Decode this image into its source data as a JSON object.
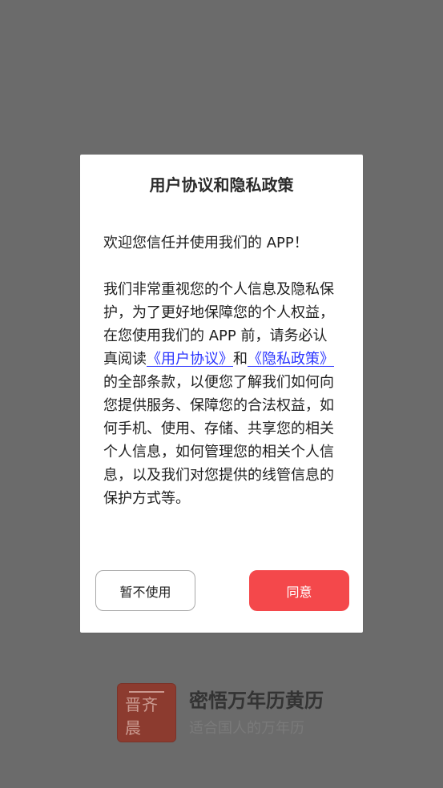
{
  "theme": {
    "overlay_color": "#6b6b6b",
    "modal_bg": "#ffffff",
    "link_color": "#2b35ff",
    "accept_button_color": "#f4484b",
    "decline_border_color": "#a8a8a8",
    "brand_logo_color": "#8c3b2f"
  },
  "modal": {
    "title": "用户协议和隐私政策",
    "welcome": "欢迎您信任并使用我们的 APP！",
    "paragraph_before_links": "我们非常重视您的个人信息及隐私保护，为了更好地保障您的个人权益，在您使用我们的 APP 前，请务必认真阅读",
    "user_agreement_link": "《用户协议》",
    "conjunction": "和",
    "privacy_policy_link": "《隐私政策》",
    "paragraph_after_links": "的全部条款，以便您了解我们如何向您提供服务、保障您的合法权益，如何手机、使用、存储、共享您的相关个人信息，如何管理您的相关个人信息，以及我们对您提供的线管信息的保护方式等。",
    "buttons": {
      "decline": "暂不使用",
      "accept": "同意"
    }
  },
  "background_app": {
    "title": "密悟万年历黄历",
    "subtitle": "适合国人的万年历",
    "logo_icon": "calendar-seal-logo",
    "logo_text": "晋齐晨"
  }
}
